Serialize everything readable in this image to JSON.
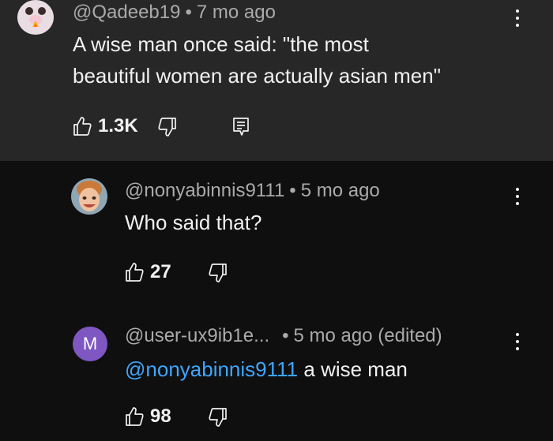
{
  "comment": {
    "author": "@Qadeeb19",
    "separator": "•",
    "time": "7 mo ago",
    "text_line1": "A wise man once said: \"the most",
    "text_line2": "beautiful women are actually asian men\"",
    "likes": "1.3K",
    "icons": {
      "like": "thumbs-up-icon",
      "dislike": "thumbs-down-icon",
      "replies": "replies-icon",
      "menu": "kebab-menu-icon"
    }
  },
  "replies": [
    {
      "author": "@nonyabinnis9111",
      "separator": "•",
      "time": "5 mo ago",
      "text": "Who said that?",
      "likes": "27"
    },
    {
      "author": "@user-ux9ib1e...",
      "separator": "•",
      "time": "5 mo ago (edited)",
      "avatar_letter": "M",
      "mention": "@nonyabinnis9111",
      "text": " a wise man",
      "likes": "98"
    }
  ],
  "colors": {
    "top_comment_bg": "#272727",
    "page_bg": "#0f0f0f",
    "mention": "#3ea6ff",
    "avatar_letter_bg": "#7e57c2"
  }
}
